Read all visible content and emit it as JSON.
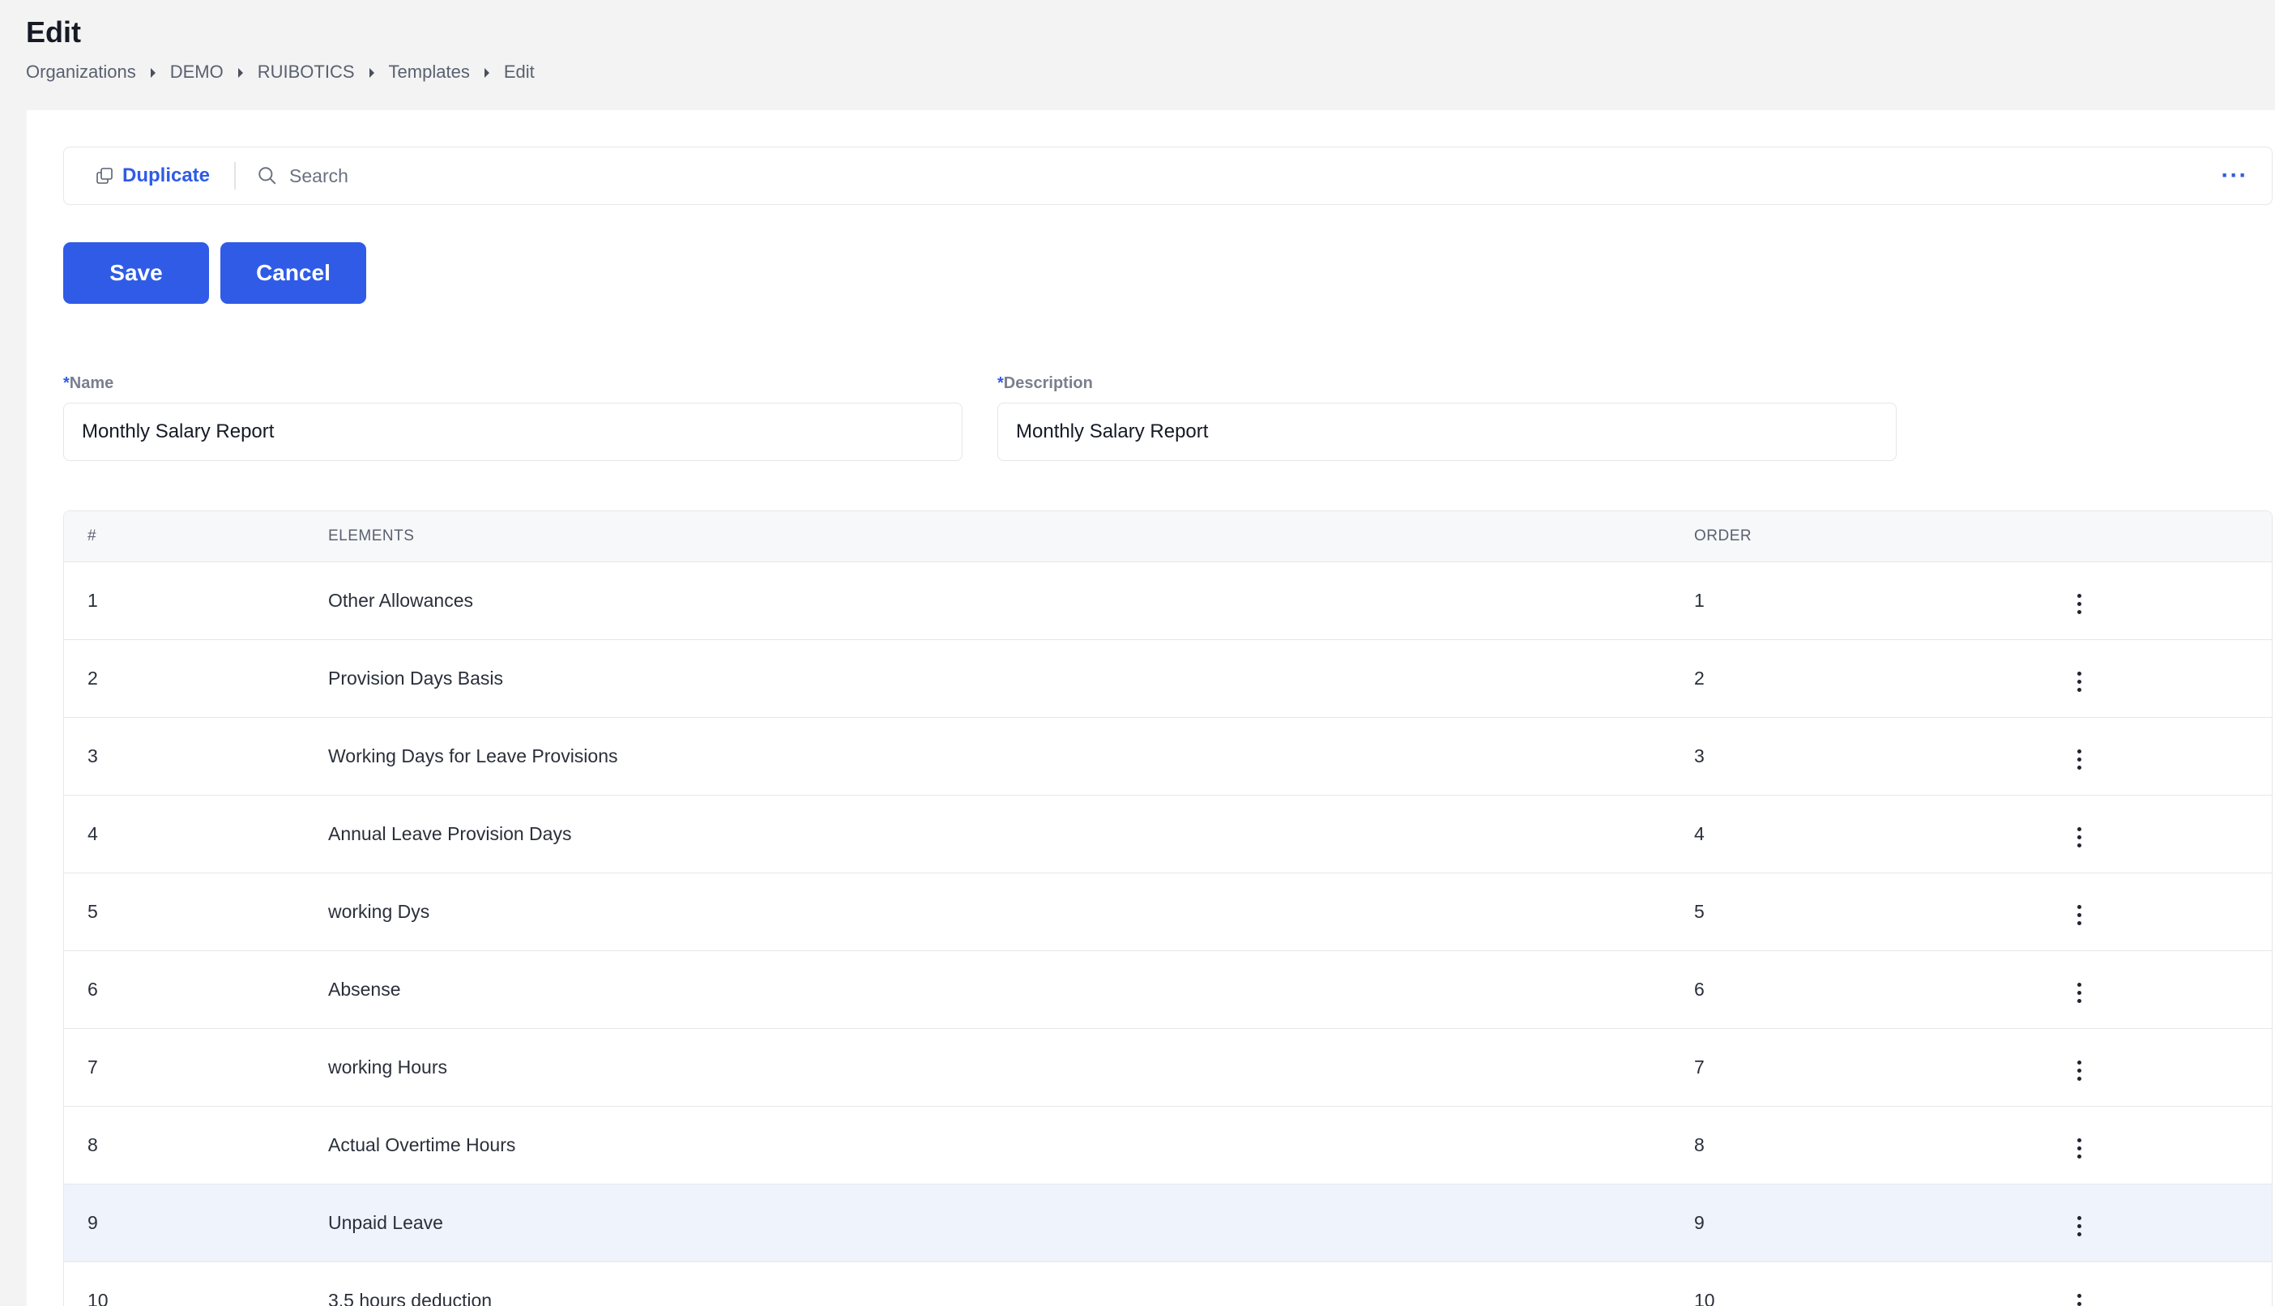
{
  "header": {
    "title": "Edit",
    "breadcrumb": [
      "Organizations",
      "DEMO",
      "RUIBOTICS",
      "Templates",
      "Edit"
    ]
  },
  "toolbar": {
    "duplicate_label": "Duplicate",
    "search_placeholder": "Search",
    "more_label": "···"
  },
  "actions": {
    "save_label": "Save",
    "cancel_label": "Cancel"
  },
  "form": {
    "name": {
      "required_mark": "*",
      "label": "Name",
      "value": "Monthly Salary Report"
    },
    "description": {
      "required_mark": "*",
      "label": "Description",
      "value": "Monthly Salary Report"
    }
  },
  "table": {
    "columns": [
      "#",
      "ELEMENTS",
      "ORDER"
    ],
    "rows": [
      {
        "num": "1",
        "element": "Other Allowances",
        "order": "1"
      },
      {
        "num": "2",
        "element": "Provision Days Basis",
        "order": "2"
      },
      {
        "num": "3",
        "element": "Working Days for Leave Provisions",
        "order": "3"
      },
      {
        "num": "4",
        "element": "Annual Leave Provision Days",
        "order": "4"
      },
      {
        "num": "5",
        "element": "working Dys",
        "order": "5"
      },
      {
        "num": "6",
        "element": "Absense",
        "order": "6"
      },
      {
        "num": "7",
        "element": "working Hours",
        "order": "7"
      },
      {
        "num": "8",
        "element": "Actual Overtime Hours",
        "order": "8"
      },
      {
        "num": "9",
        "element": "Unpaid Leave",
        "order": "9"
      },
      {
        "num": "10",
        "element": "3.5 hours deduction",
        "order": "10"
      }
    ],
    "highlighted_row": 9
  },
  "colors": {
    "accent": "#2f5be7",
    "page_bg": "#f3f3f3",
    "row_highlight": "#eef3fc"
  },
  "icons": {
    "duplicate": "copy-icon",
    "search": "search-icon",
    "more": "more-horizontal-icon",
    "breadcrumb_separator": "chevron-right-icon",
    "row_menu": "more-vertical-icon"
  }
}
